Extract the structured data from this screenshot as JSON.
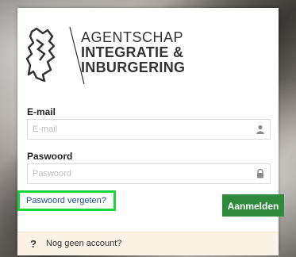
{
  "logo": {
    "line1": "AGENTSCHAP",
    "line2": "INTEGRATIE &",
    "line3": "INBURGERING",
    "mark_icon": "flemish-lion-icon"
  },
  "form": {
    "email": {
      "label": "E-mail",
      "placeholder": "E-mail",
      "value": "",
      "icon": "user-icon"
    },
    "password": {
      "label": "Paswoord",
      "placeholder": "Paswoord",
      "value": "",
      "icon": "lock-icon"
    },
    "forgot_link": "Paswoord vergeten?",
    "submit_label": "Aanmelden"
  },
  "footer": {
    "icon": "?",
    "text": "Nog geen account?"
  },
  "colors": {
    "primary_button": "#2f8a3e",
    "highlight_border": "#1bd33a",
    "link": "#1c4e85",
    "footer_bg": "#fcf3e6"
  }
}
